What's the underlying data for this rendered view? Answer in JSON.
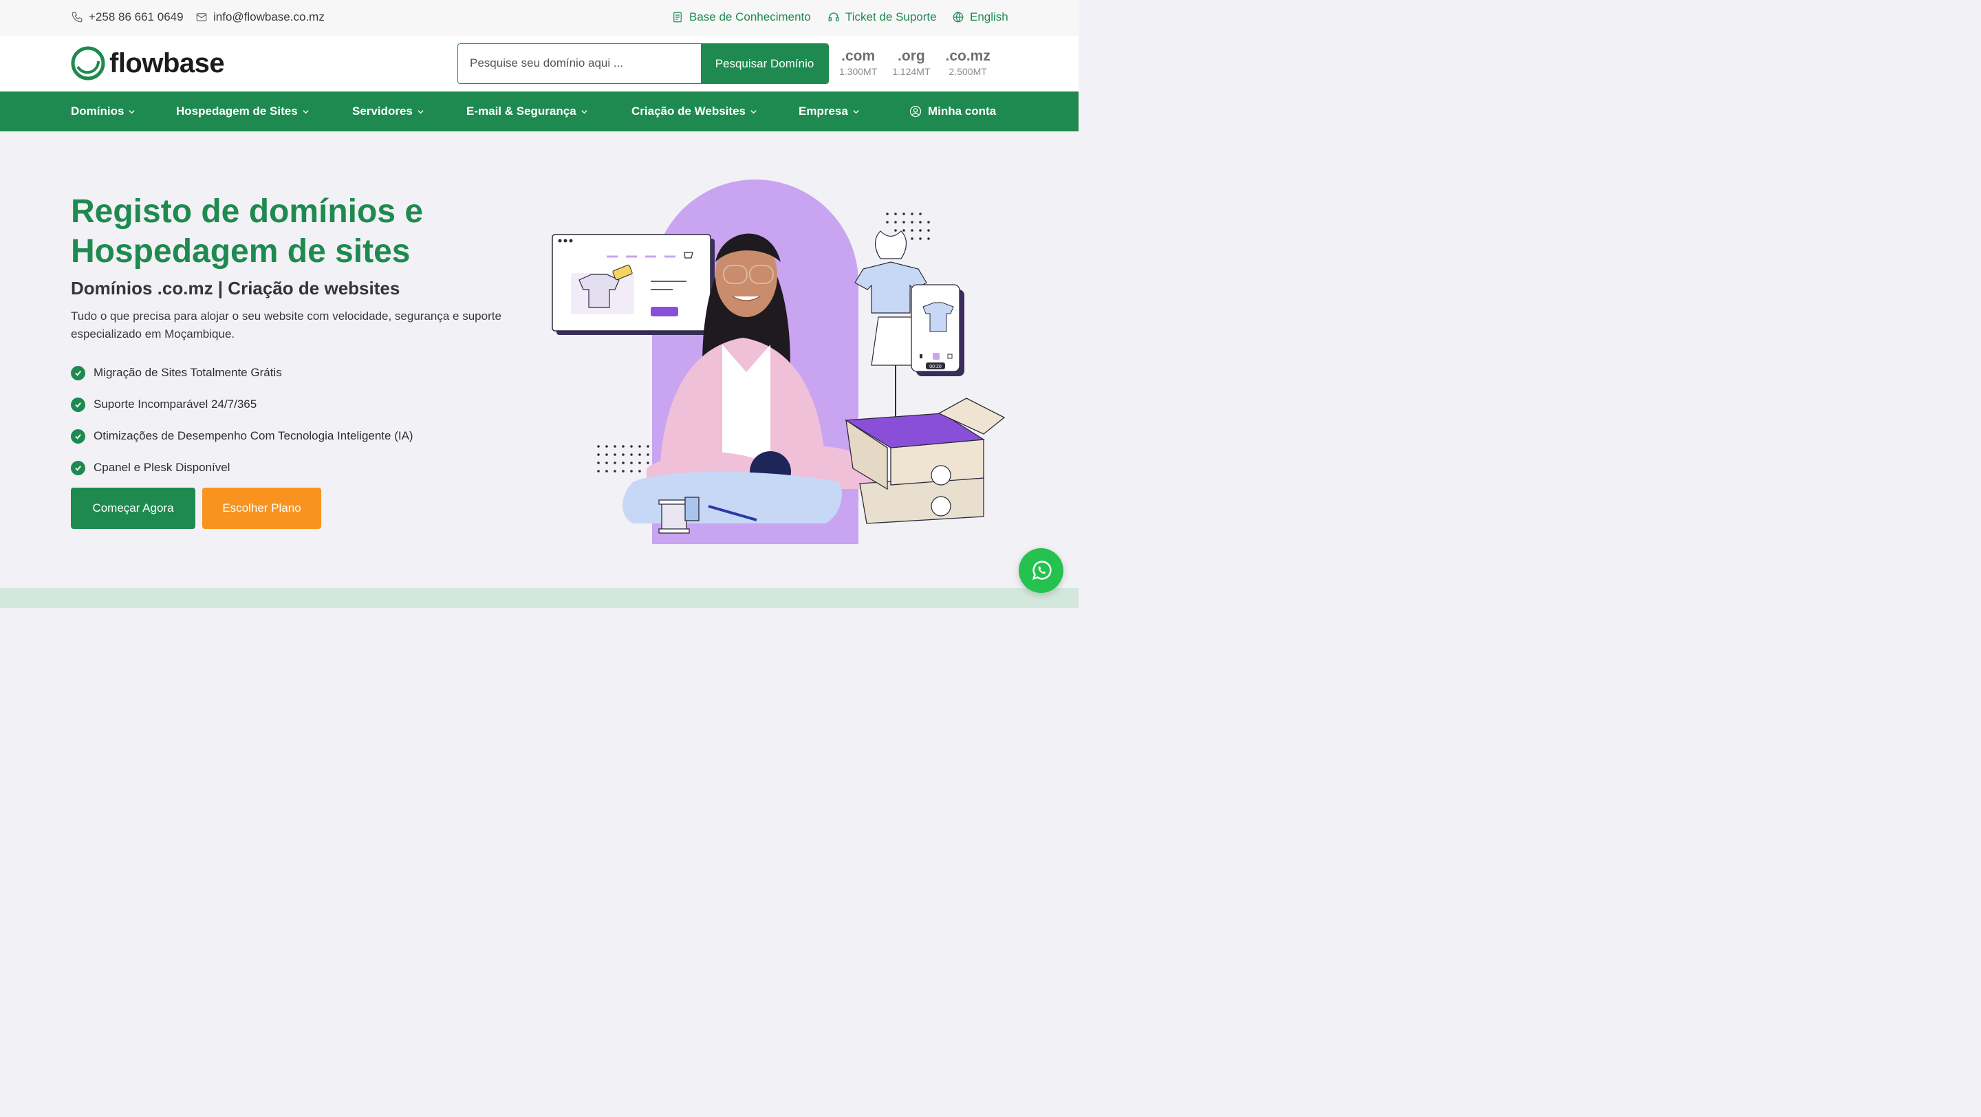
{
  "topbar": {
    "phone": "+258 86 661 0649",
    "email": "info@flowbase.co.mz",
    "knowledge_base": "Base de Conhecimento",
    "support_ticket": "Ticket de Suporte",
    "language": "English"
  },
  "header": {
    "logo_text": "flowbase",
    "search_placeholder": "Pesquise seu domínio aqui ...",
    "search_button": "Pesquisar Domínio",
    "tlds": [
      {
        "ext": ".com",
        "price": "1.300MT"
      },
      {
        "ext": ".org",
        "price": "1.124MT"
      },
      {
        "ext": ".co.mz",
        "price": "2.500MT"
      }
    ]
  },
  "nav": {
    "items": [
      "Domínios",
      "Hospedagem de Sites",
      "Servidores",
      "E-mail & Segurança",
      "Criação de Websites",
      "Empresa"
    ],
    "account": "Minha conta"
  },
  "hero": {
    "title": "Registo de domínios e Hospedagem de sites",
    "subtitle": "Domínios .co.mz | Criação de websites",
    "description": "Tudo o que precisa para alojar o seu website com velocidade, segurança e suporte especializado em Moçambique.",
    "features": [
      "Migração de Sites Totalmente Grátis",
      "Suporte Incomparável 24/7/365",
      "Otimizações de Desempenho Com Tecnologia Inteligente (IA)",
      "Cpanel e Plesk Disponível"
    ],
    "primary_button": "Começar Agora",
    "secondary_button": "Escolher Plano",
    "video_time": "00:20"
  },
  "colors": {
    "brand_green": "#1e8a4f",
    "accent_orange": "#f7931e",
    "purple": "#c9a4f0",
    "whatsapp_green": "#26c24f"
  }
}
